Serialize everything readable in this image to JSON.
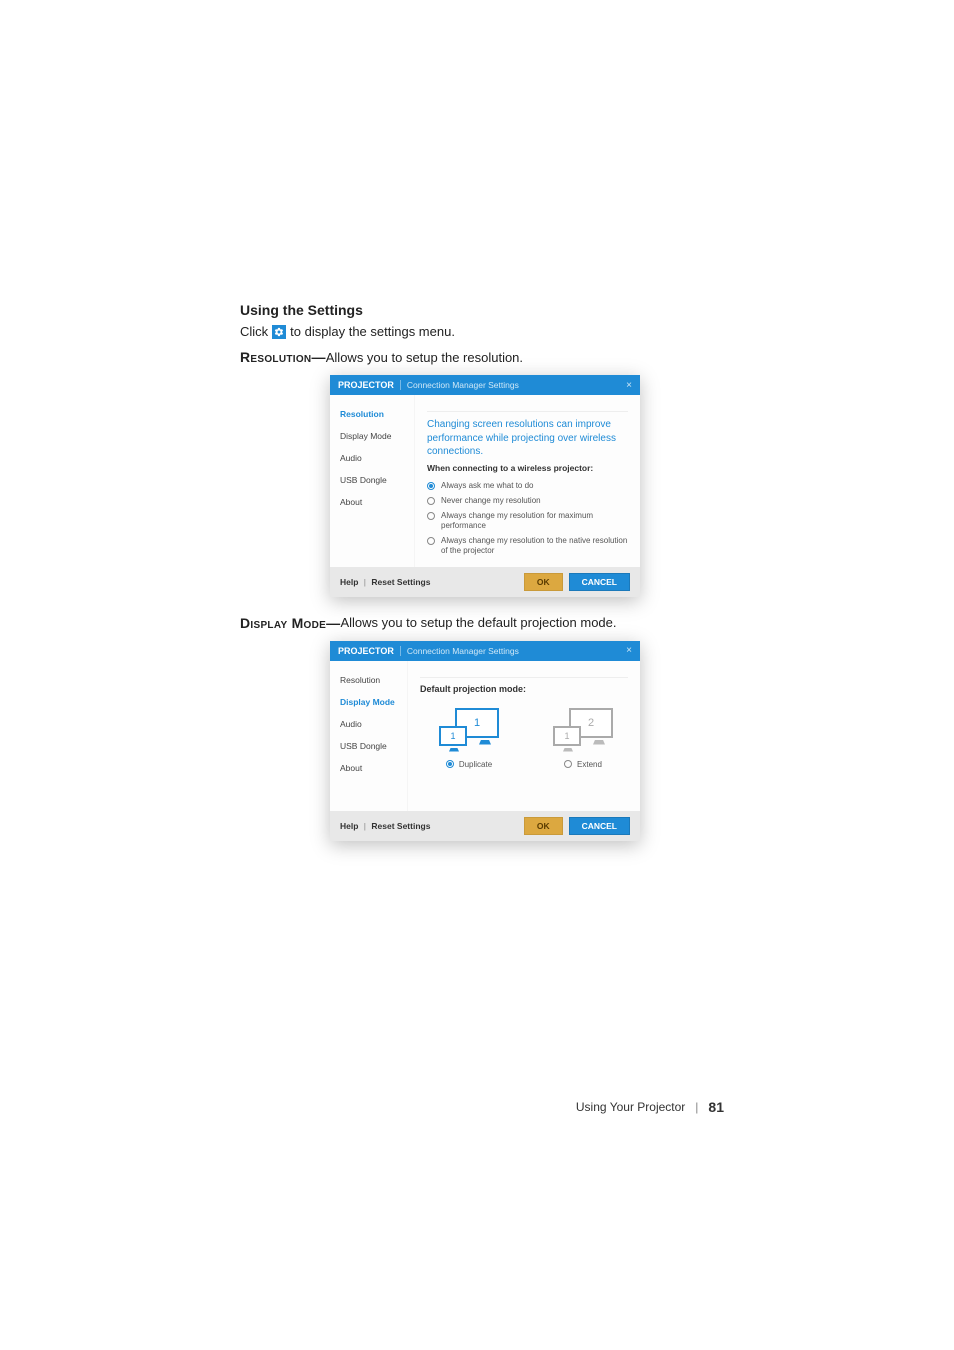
{
  "headings": {
    "using_settings": "Using the Settings"
  },
  "intro": {
    "click": "Click",
    "rest": "to display the settings menu."
  },
  "sections": {
    "resolution_label": "Resolution—",
    "resolution_desc": "Allows you to setup the resolution.",
    "display_mode_label": "Display Mode—",
    "display_mode_desc": "Allows you to setup the default projection mode."
  },
  "dialog": {
    "title_bold": "PROJECTOR",
    "title_sub": "Connection Manager Settings",
    "close": "×",
    "sidebar": [
      "Resolution",
      "Display Mode",
      "Audio",
      "USB Dongle",
      "About"
    ],
    "footer": {
      "help": "Help",
      "reset": "Reset Settings",
      "ok": "OK",
      "cancel": "CANCEL"
    }
  },
  "resolution_panel": {
    "headline": "Changing screen resolutions can improve performance while projecting over wireless connections.",
    "subhead": "When connecting to a wireless projector:",
    "options": [
      "Always ask me what to do",
      "Never change my resolution",
      "Always change my resolution for maximum performance",
      "Always change my resolution to the native resolution of the projector"
    ],
    "selected_index": 0
  },
  "display_panel": {
    "headline": "Default projection mode:",
    "options": [
      "Duplicate",
      "Extend"
    ],
    "selected_index": 0
  },
  "footer": {
    "text": "Using Your Projector",
    "page": "81"
  }
}
